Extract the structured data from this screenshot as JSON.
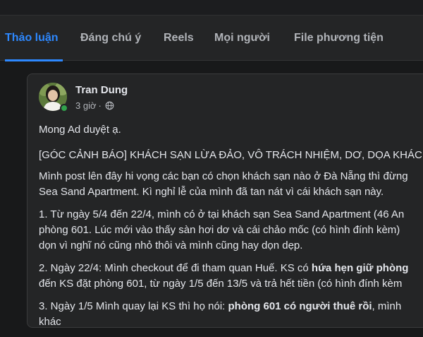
{
  "tabs": [
    {
      "label": "Thảo luận",
      "active": true
    },
    {
      "label": "Đáng chú ý",
      "active": false
    },
    {
      "label": "Reels",
      "active": false
    },
    {
      "label": "Mọi người",
      "active": false
    },
    {
      "label": "File phương tiện",
      "active": false
    }
  ],
  "post": {
    "author": "Tran Dung",
    "time": "3 giờ",
    "separator": "·",
    "privacy_icon": "globe-icon",
    "paragraphs": {
      "p1": "Mong Ad duyệt ạ.",
      "p2": "[GÓC CẢNH BÁO] KHÁCH SẠN LỪA ĐẢO, VÔ TRÁCH NHIỆM, DƠ, DỌA KHÁCH",
      "p3_l1": "Mình post lên đây hi vọng các bạn có chọn khách sạn nào ở Đà Nẵng thì đừng",
      "p3_l2": "Sea Sand Apartment. Kì nghỉ lễ của mình đã tan nát vì cái khách sạn này.",
      "p4_l1": "1. Từ ngày 5/4 đến 22/4, mình có ở tại khách sạn Sea Sand Apartment (46 An",
      "p4_l2": "phòng 601. Lúc mới vào thấy sàn hơi dơ và cái chảo mốc (có hình đính kèm)",
      "p4_l3": "dọn vì nghĩ nó cũng nhỏ thôi và mình cũng hay dọn dẹp.",
      "p5_l1_a": "2. Ngày 22/4: Mình checkout để đi tham quan Huế. KS có ",
      "p5_l1_b": "hứa hẹn giữ phòng",
      "p5_l2": "đến KS đặt phòng 601, từ ngày 1/5 đến 13/5 và trả hết tiền (có hình đính kèm",
      "p6_l1_a": "3. Ngày 1/5 Mình quay lại KS thì họ nói: ",
      "p6_l1_b": "phòng 601 có người thuê rồi",
      "p6_l1_c": ", mình",
      "p6_l2": "khác"
    }
  },
  "colors": {
    "background": "#18191a",
    "surface": "#242526",
    "accent": "#2d88ff",
    "text_primary": "#e4e6eb",
    "text_secondary": "#b0b3b8",
    "online": "#31a24c"
  }
}
